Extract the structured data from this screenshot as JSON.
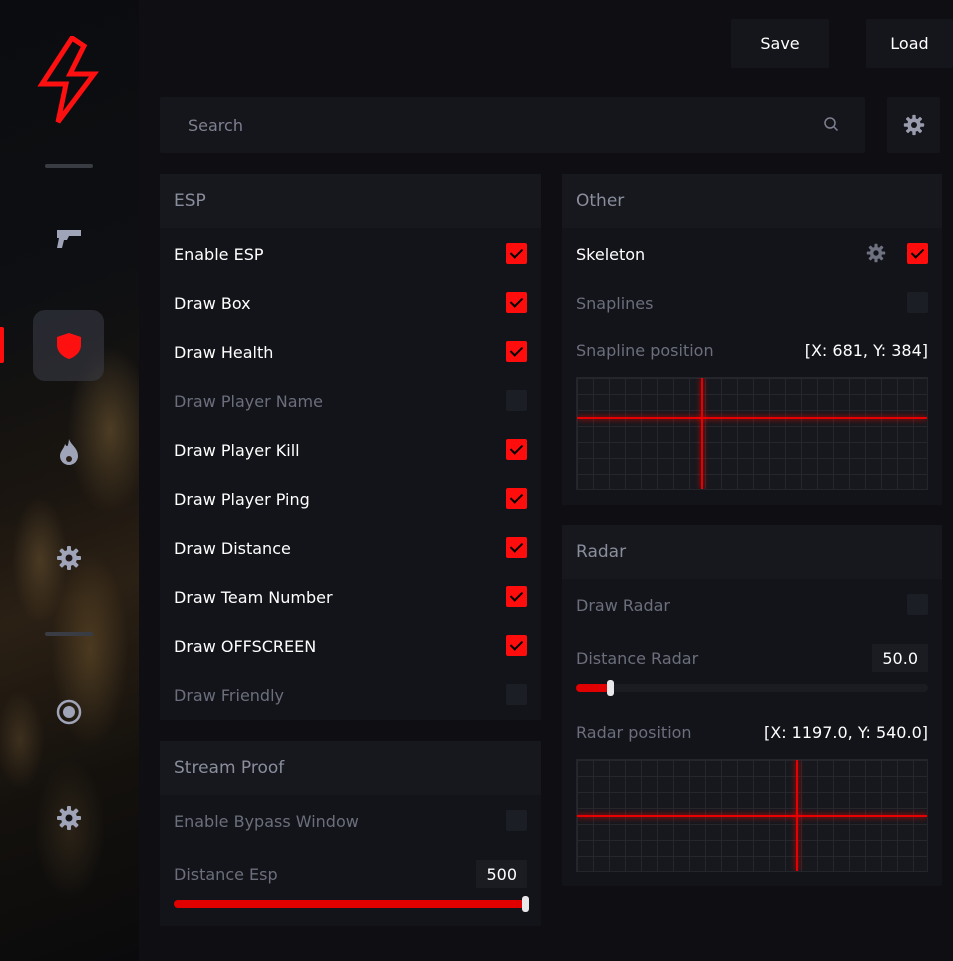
{
  "toolbar": {
    "save_label": "Save",
    "load_label": "Load"
  },
  "search": {
    "placeholder": "Search"
  },
  "sidebar": {
    "items": [
      {
        "icon": "gun-icon"
      },
      {
        "icon": "shield-icon",
        "active": true
      },
      {
        "icon": "fire-icon"
      },
      {
        "icon": "gear-icon"
      },
      {
        "icon": "radar-icon"
      },
      {
        "icon": "settings-gear-icon"
      }
    ]
  },
  "esp": {
    "title": "ESP",
    "items": [
      {
        "label": "Enable ESP",
        "checked": true
      },
      {
        "label": "Draw Box",
        "checked": true
      },
      {
        "label": "Draw Health",
        "checked": true
      },
      {
        "label": "Draw Player Name",
        "checked": false
      },
      {
        "label": "Draw Player Kill",
        "checked": true
      },
      {
        "label": "Draw Player Ping",
        "checked": true
      },
      {
        "label": "Draw Distance",
        "checked": true
      },
      {
        "label": "Draw Team Number",
        "checked": true
      },
      {
        "label": "Draw OFFSCREEN",
        "checked": true
      },
      {
        "label": "Draw Friendly",
        "checked": false
      }
    ]
  },
  "stream_proof": {
    "title": "Stream Proof",
    "bypass_label": "Enable Bypass Window",
    "bypass_checked": false,
    "distance_label": "Distance Esp",
    "distance_value": "500",
    "distance_fraction": 1.0
  },
  "other": {
    "title": "Other",
    "skeleton_label": "Skeleton",
    "skeleton_checked": true,
    "snaplines_label": "Snaplines",
    "snaplines_checked": false,
    "snapline_position_label": "Snapline position",
    "snapline_position_value": "[X: 681, Y: 384]"
  },
  "radar": {
    "title": "Radar",
    "draw_label": "Draw Radar",
    "draw_checked": false,
    "distance_label": "Distance Radar",
    "distance_value": "50.0",
    "distance_fraction": 0.1,
    "position_label": "Radar position",
    "position_value": "[X: 1197.0, Y: 540.0]"
  },
  "colors": {
    "accent": "#ff0d0d",
    "panel": "#131419",
    "background": "#0f0f13"
  }
}
